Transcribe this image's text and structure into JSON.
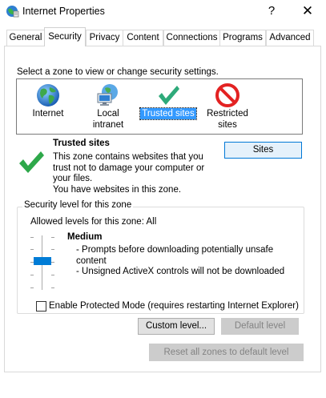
{
  "window": {
    "title": "Internet Properties",
    "help_glyph": "?",
    "close_glyph": "✕"
  },
  "tabs": [
    {
      "label": "General",
      "active": false
    },
    {
      "label": "Security",
      "active": true
    },
    {
      "label": "Privacy",
      "active": false
    },
    {
      "label": "Content",
      "active": false
    },
    {
      "label": "Connections",
      "active": false
    },
    {
      "label": "Programs",
      "active": false
    },
    {
      "label": "Advanced",
      "active": false
    }
  ],
  "security": {
    "zone_prompt": "Select a zone to view or change security settings.",
    "zones": [
      {
        "label": "Internet",
        "icon": "globe-icon"
      },
      {
        "label": "Local intranet",
        "icon": "network-computer-icon"
      },
      {
        "label": "Trusted sites",
        "icon": "checkmark-icon",
        "selected": true
      },
      {
        "label_line1": "Restricted",
        "label_line2": "sites",
        "icon": "restricted-icon"
      }
    ],
    "selected_zone": {
      "title": "Trusted sites",
      "desc_lines": [
        "This zone contains websites that you",
        "trust not to damage your computer or",
        "your files.",
        "You have websites in this zone."
      ]
    },
    "sites_button": "Sites",
    "level_group": {
      "caption": "Security level for this zone",
      "allowed_label": "Allowed levels for this zone: All",
      "level_name": "Medium",
      "level_desc": [
        "- Prompts before downloading potentially unsafe",
        "content",
        "- Unsigned ActiveX controls will not be downloaded"
      ],
      "protected_mode_label": "Enable Protected Mode (requires restarting Internet Explorer)",
      "protected_mode_checked": false,
      "custom_level_button": "Custom level...",
      "default_level_button": "Default level"
    },
    "reset_all_button": "Reset all zones to default level"
  },
  "colors": {
    "selection": "#3399ff",
    "slider_thumb": "#007cd6",
    "check_green": "#2ea84a",
    "restricted_red": "#e32222"
  }
}
